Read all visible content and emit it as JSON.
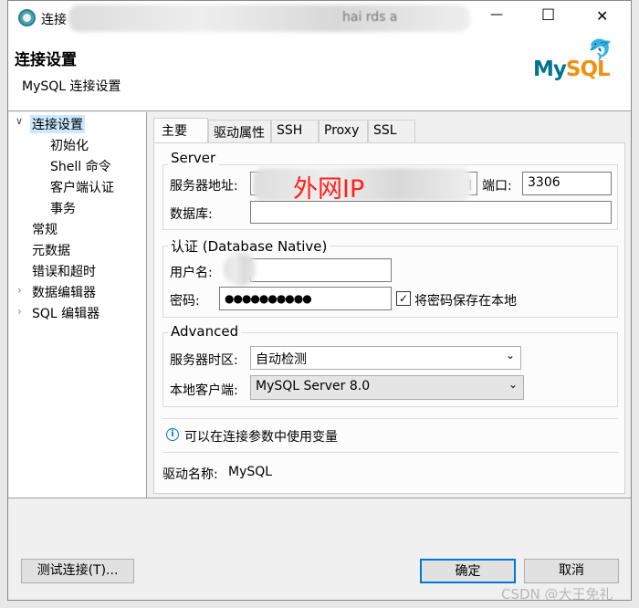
{
  "window": {
    "title": "连接",
    "title_blurred_suffix": "hai rds a",
    "controls": {
      "minimize": "—",
      "maximize": "☐",
      "close": "✕"
    }
  },
  "header": {
    "title": "连接设置",
    "subtitle": "MySQL 连接设置",
    "logo_text_my": "My",
    "logo_text_sql": "SQL",
    "logo_colors": {
      "my": "#00758f",
      "sql": "#f29111"
    }
  },
  "tree": {
    "items": [
      {
        "label": "连接设置",
        "expanded": true,
        "selected": true
      },
      {
        "label": "初始化",
        "child": true
      },
      {
        "label": "Shell 命令",
        "child": true
      },
      {
        "label": "客户端认证",
        "child": true
      },
      {
        "label": "事务",
        "child": true
      },
      {
        "label": "常规"
      },
      {
        "label": "元数据"
      },
      {
        "label": "错误和超时"
      },
      {
        "label": "数据编辑器",
        "collapsed": true
      },
      {
        "label": "SQL 编辑器",
        "collapsed": true
      }
    ]
  },
  "tabs": [
    {
      "label": "主要",
      "active": true
    },
    {
      "label": "驱动属性"
    },
    {
      "label": "SSH"
    },
    {
      "label": "Proxy"
    },
    {
      "label": "SSL"
    }
  ],
  "server": {
    "legend": "Server",
    "host_label": "服务器地址:",
    "host_overlay": "外网IP",
    "host_tail": "q",
    "port_label": "端口:",
    "port_value": "3306",
    "db_label": "数据库:",
    "db_value": ""
  },
  "auth": {
    "legend": "认证 (Database Native)",
    "user_label": "用户名:",
    "password_label": "密码:",
    "password_value": "●●●●●●●●●●",
    "save_password_label": "将密码保存在本地",
    "save_password_checked": true
  },
  "advanced": {
    "legend": "Advanced",
    "timezone_label": "服务器时区:",
    "timezone_value": "自动检测",
    "client_label": "本地客户端:",
    "client_value": "MySQL Server 8.0"
  },
  "info": {
    "icon": "info-icon",
    "text": "可以在连接参数中使用变量"
  },
  "driver": {
    "label": "驱动名称:",
    "value": "MySQL"
  },
  "buttons": {
    "test": "测试连接(T)...",
    "ok": "确定",
    "cancel": "取消"
  },
  "accent": "#0078d7",
  "watermark": "CSDN @大王免礼"
}
